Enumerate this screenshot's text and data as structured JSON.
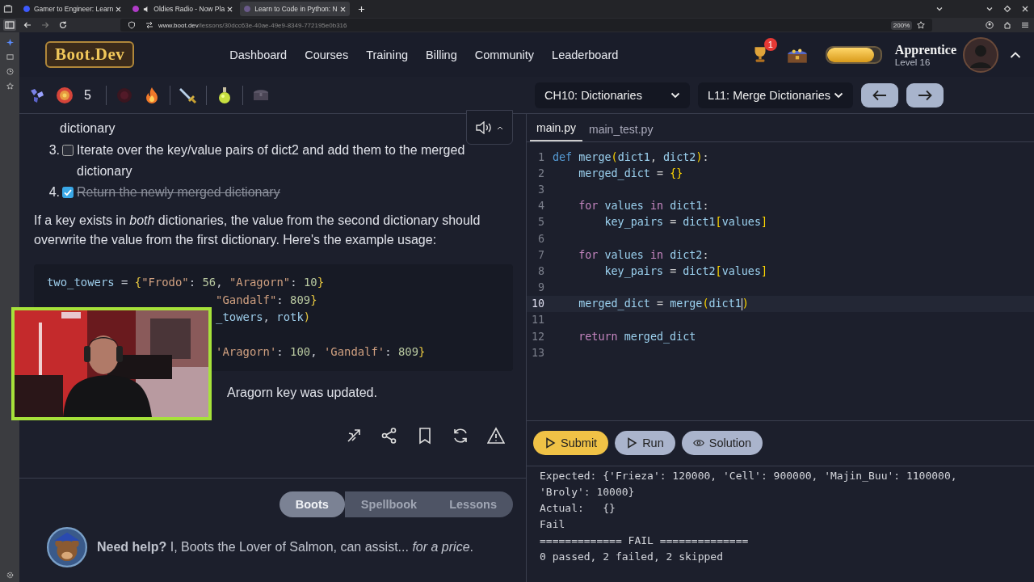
{
  "browser": {
    "tabs": [
      {
        "title": "Gamer to Engineer: Learn",
        "selected": false,
        "audio": false
      },
      {
        "title": "Oldies Radio - Now Pla",
        "selected": false,
        "audio": true
      },
      {
        "title": "Learn to Code in Python: N",
        "selected": true,
        "audio": false
      }
    ],
    "url": "www.boot.dev/lessons/30dcc63e-40ae-49e9-8349-772195e0b316",
    "zoom": "200%"
  },
  "header": {
    "logo": "Boot.Dev",
    "nav": [
      "Dashboard",
      "Courses",
      "Training",
      "Billing",
      "Community",
      "Leaderboard"
    ],
    "notification_count": "1",
    "xp": {
      "level": 0.88
    },
    "rank": "Apprentice",
    "level_label": "Level 16"
  },
  "toolbar": {
    "gem_count": "5",
    "chapter": "CH10: Dictionaries",
    "lesson": "L11: Merge Dictionaries"
  },
  "lesson": {
    "continued_step": "dictionary",
    "steps": [
      {
        "number": "3.",
        "text": "Iterate over the key/value pairs of dict2 and add them to the merged dictionary",
        "checked": false
      },
      {
        "number": "4.",
        "text": "Return the newly merged dictionary",
        "checked": true
      }
    ],
    "paragraph": "If a key exists in *both* dictionaries, the value from the second dictionary should overwrite the value from the first dictionary. Here's the example usage:",
    "example_code": [
      "two_towers = {\"Frodo\": 56, \"Aragorn\": 10}",
      "\"Gandalf\": 809}",
      "_towers, rotk)",
      "'Aragorn': 100, 'Gandalf': 809}"
    ],
    "note": "Aragorn key was updated.",
    "help_tabs": [
      {
        "label": "Boots",
        "selected": true
      },
      {
        "label": "Spellbook",
        "selected": false
      },
      {
        "label": "Lessons",
        "selected": false
      }
    ],
    "help_text": "**Need help?** I, Boots the Lover of Salmon, can assist... *for a price*."
  },
  "editor": {
    "tabs": [
      {
        "label": "main.py",
        "selected": true
      },
      {
        "label": "main_test.py",
        "selected": false
      }
    ],
    "lines": [
      {
        "number": "1",
        "code": "def merge(dict1, dict2):",
        "current": false
      },
      {
        "number": "2",
        "code": "    merged_dict = {}",
        "current": false
      },
      {
        "number": "3",
        "current": false
      },
      {
        "number": "4",
        "code": "    for values in dict1:",
        "current": false
      },
      {
        "number": "5",
        "code": "        key_pairs = dict1[values]",
        "current": false
      },
      {
        "number": "6",
        "current": false
      },
      {
        "number": "7",
        "code": "    for values in dict2:",
        "current": false
      },
      {
        "number": "8",
        "code": "        key_pairs = dict2[values]",
        "current": false
      },
      {
        "number": "9",
        "current": false
      },
      {
        "number": "10",
        "code": "    merged_dict = merge(dict1)",
        "current": true
      },
      {
        "number": "11",
        "current": false
      },
      {
        "number": "12",
        "code": "    return merged_dict",
        "current": false
      },
      {
        "number": "13",
        "current": false
      }
    ],
    "buttons": [
      {
        "label": "Submit",
        "kind": "submit"
      },
      {
        "label": "Run",
        "kind": "run"
      },
      {
        "label": "Solution",
        "kind": "solution"
      }
    ],
    "output": [
      "Expected: {'Frieza': 120000, 'Cell': 900000, 'Majin_Buu': 1100000,",
      "'Broly': 10000}",
      "Actual:   {}",
      "Fail",
      "============= FAIL ==============",
      "0 passed, 2 failed, 2 skipped"
    ]
  }
}
